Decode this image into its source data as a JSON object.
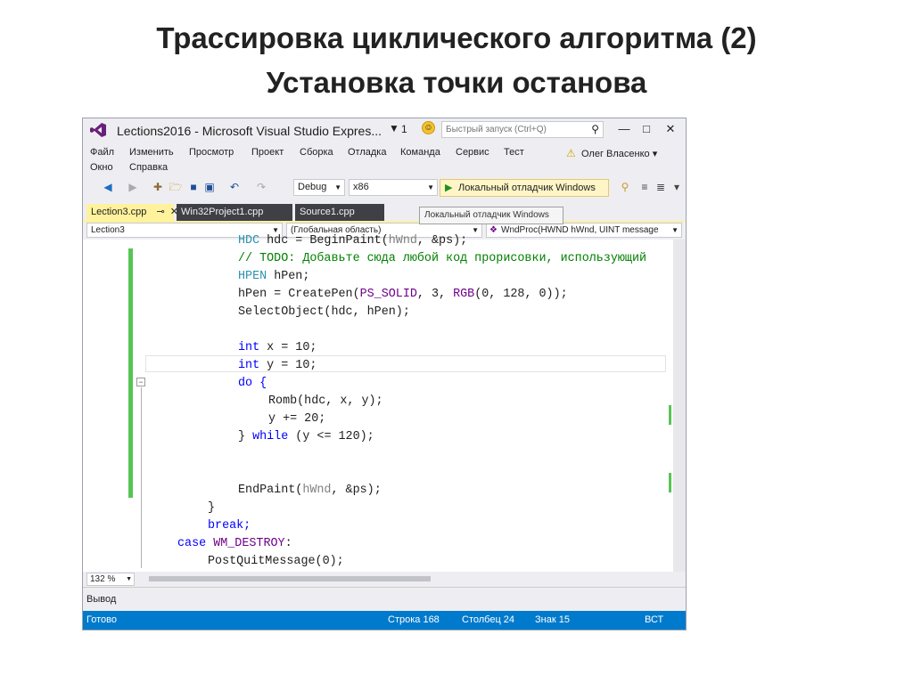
{
  "slide": {
    "title_line1": "Трассировка циклического алгоритма (2)",
    "title_line2": "Установка точки останова"
  },
  "window": {
    "app_title": "Lections2016 - Microsoft Visual Studio Expres...",
    "notification_count": "1",
    "quick_launch_placeholder": "Быстрый запуск (Ctrl+Q)",
    "user_name": "Олег Власенко",
    "min_glyph": "—",
    "max_glyph": "□",
    "close_glyph": "✕"
  },
  "menu": {
    "row1": [
      "Файл",
      "Изменить",
      "Просмотр",
      "Проект",
      "Сборка",
      "Отладка",
      "Команда",
      "Сервис",
      "Тест"
    ],
    "row2": [
      "Окно",
      "Справка"
    ]
  },
  "toolbar": {
    "configuration": "Debug",
    "platform": "x86",
    "start_label": "Локальный отладчик Windows",
    "tooltip": "Локальный отладчик Windows"
  },
  "tabs": [
    "Lection3.cpp",
    "Win32Project1.cpp",
    "Source1.cpp"
  ],
  "navbar": {
    "project": "Lection3",
    "scope": "(Глобальная область)",
    "member": "WndProc(HWND hWnd, UINT message"
  },
  "code_lines": [
    "HDC hdc = BeginPaint(hWnd, &ps);",
    "// TODO: Добавьте сюда любой код прорисовки, использующий",
    "HPEN hPen;",
    "hPen = CreatePen(PS_SOLID, 3, RGB(0, 128, 0));",
    "SelectObject(hdc, hPen);",
    "",
    "int x = 10;",
    "int y = 10;",
    "do {",
    "Romb(hdc, x, y);",
    "y += 20;",
    "} while (y <= 120);",
    "",
    "",
    "EndPaint(hWnd, &ps);",
    "}",
    "break;",
    "case WM_DESTROY:",
    "PostQuitMessage(0);"
  ],
  "zoom": "132 %",
  "output_label": "Вывод",
  "status": {
    "ready": "Готово",
    "row": "Строка 168",
    "col": "Столбец 24",
    "char": "Знак 15",
    "mode": "ВСТ"
  },
  "colors": {
    "keyword": "#0000ff",
    "comment": "#008000",
    "macro": "#6f008a",
    "status_bar": "#007acc",
    "active_tab": "#fff29d",
    "change_bar": "#57c553"
  }
}
